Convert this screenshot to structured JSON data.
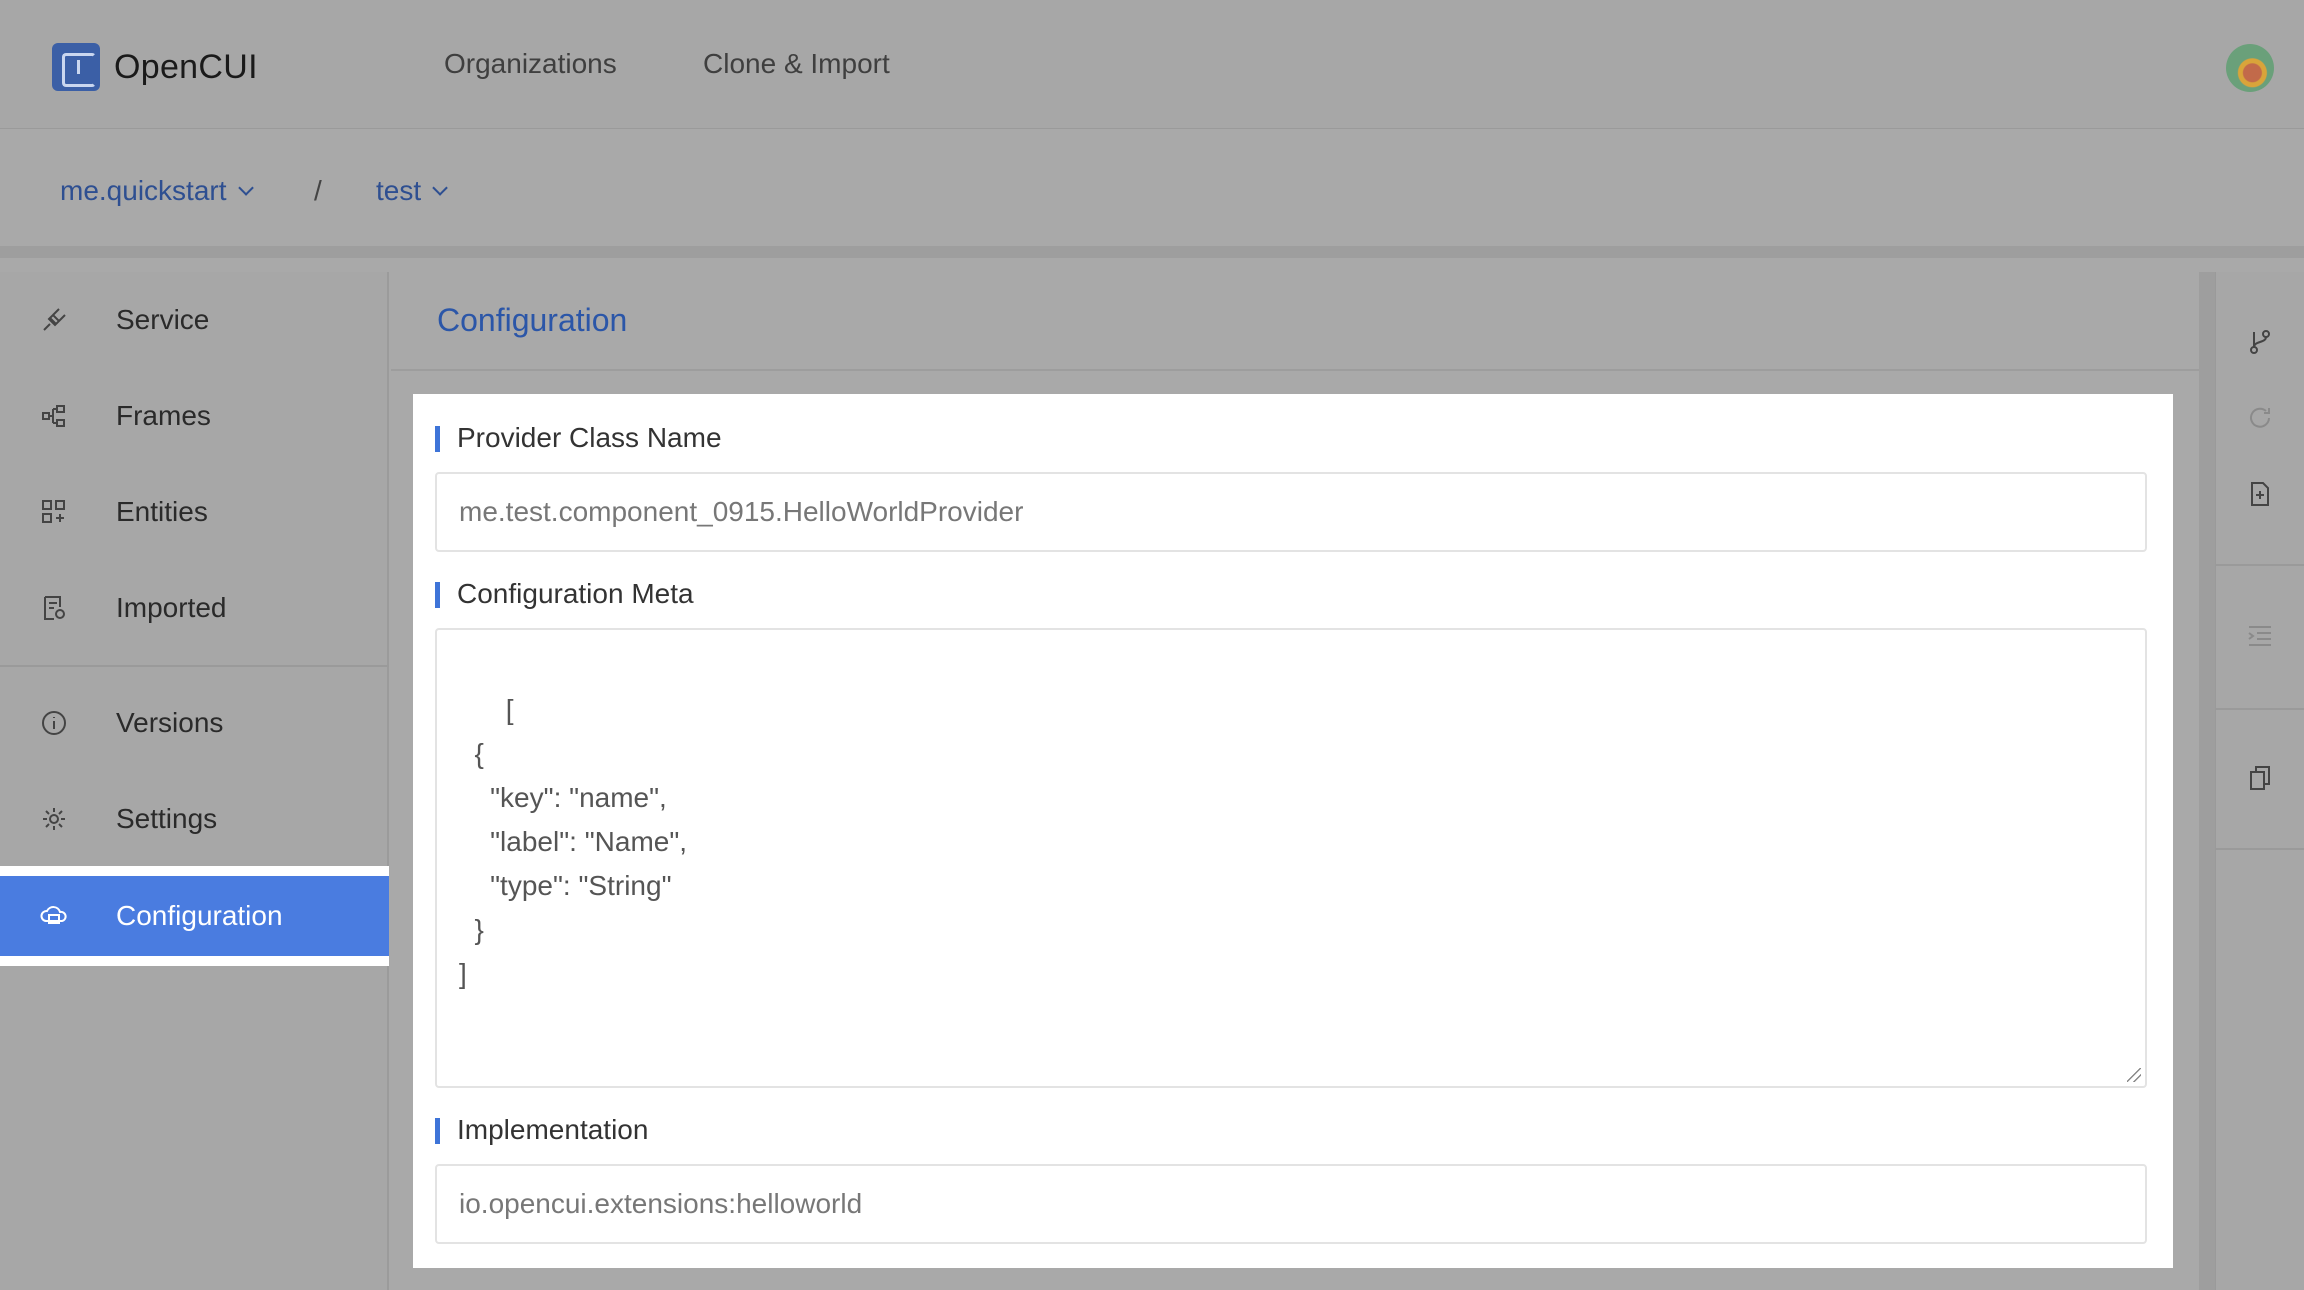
{
  "app": {
    "name": "OpenCUI"
  },
  "topnav": {
    "organizations": "Organizations",
    "clone_import": "Clone & Import"
  },
  "breadcrumb": {
    "org": "me.quickstart",
    "separator": "/",
    "project": "test"
  },
  "sidebar": {
    "items": [
      {
        "label": "Service",
        "icon": "plug-icon"
      },
      {
        "label": "Frames",
        "icon": "frames-icon"
      },
      {
        "label": "Entities",
        "icon": "entities-grid-icon"
      },
      {
        "label": "Imported",
        "icon": "imported-doc-icon"
      },
      {
        "label": "Versions",
        "icon": "info-circle-icon"
      },
      {
        "label": "Settings",
        "icon": "gear-icon"
      },
      {
        "label": "Configuration",
        "icon": "cloud-config-icon",
        "active": true
      }
    ]
  },
  "main": {
    "title": "Configuration",
    "provider_label": "Provider Class Name",
    "provider_value": "me.test.component_0915.HelloWorldProvider",
    "meta_label": "Configuration Meta",
    "meta_value": "[\n  {\n    \"key\": \"name\",\n    \"label\": \"Name\",\n    \"type\": \"String\"\n  }\n]",
    "impl_label": "Implementation",
    "impl_value": "io.opencui.extensions:helloworld"
  },
  "toolbar": {
    "icons": [
      "branch-icon",
      "refresh-icon",
      "document-plus-icon",
      "indent-icon",
      "copy-icon"
    ]
  },
  "colors": {
    "accent": "#4a7ce0",
    "title": "#2b56a8",
    "brand": "#3b5fa6"
  }
}
